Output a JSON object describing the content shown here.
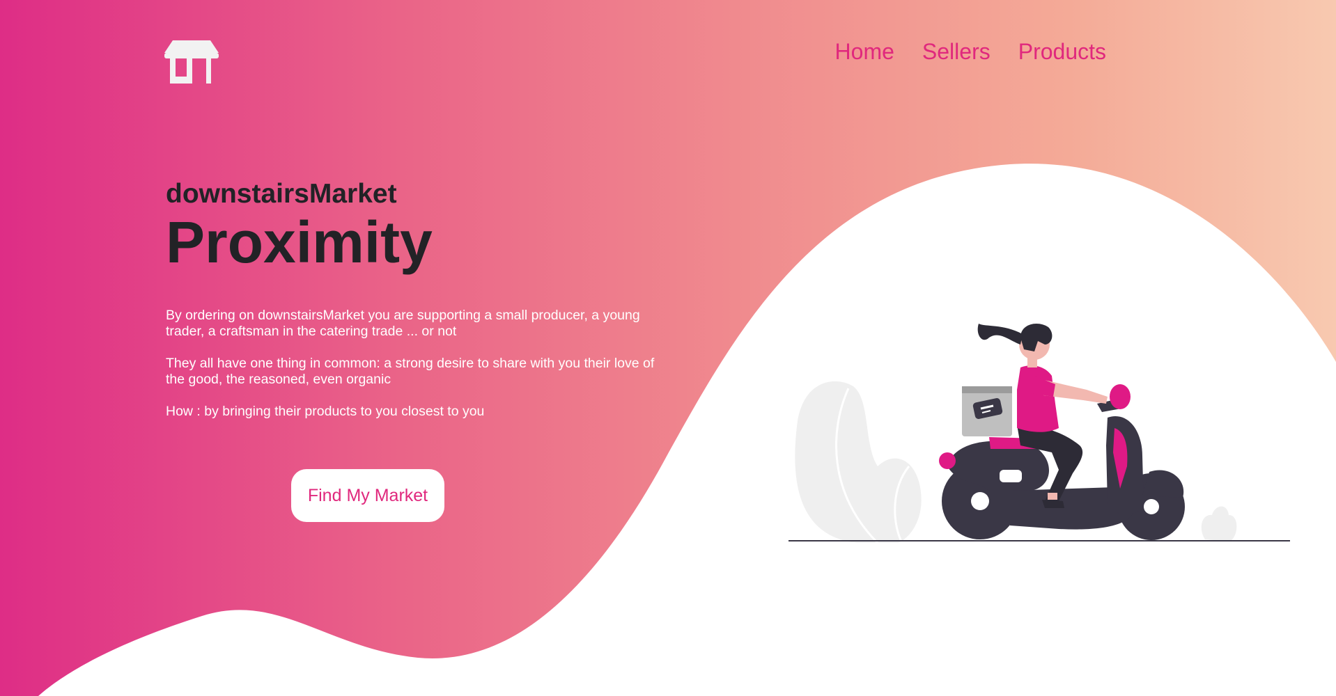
{
  "nav": {
    "items": [
      {
        "label": "Home"
      },
      {
        "label": "Sellers"
      },
      {
        "label": "Products"
      }
    ]
  },
  "logo": {
    "icon": "storefront-icon",
    "color": "#f2f2f2"
  },
  "hero": {
    "brand": "downstairsMarket",
    "headline": "Proximity",
    "paragraphs": [
      "By ordering on downstairsMarket you are supporting a small producer, a young trader, a craftsman in the catering trade ... or not",
      "They all have one thing in common: a strong desire to share with you their love of the good, the reasoned, even organic",
      "How : by bringing their products to you closest to you"
    ],
    "cta_label": "Find My Market"
  },
  "illustration": {
    "icon": "scooter-delivery-illustration"
  },
  "colors": {
    "accent": "#e0287d",
    "gradient_start": "#de2d86",
    "gradient_end": "#f8c9b0",
    "text_dark": "#222226",
    "scooter": "#3a3746",
    "rider_shirt": "#df1a85"
  }
}
